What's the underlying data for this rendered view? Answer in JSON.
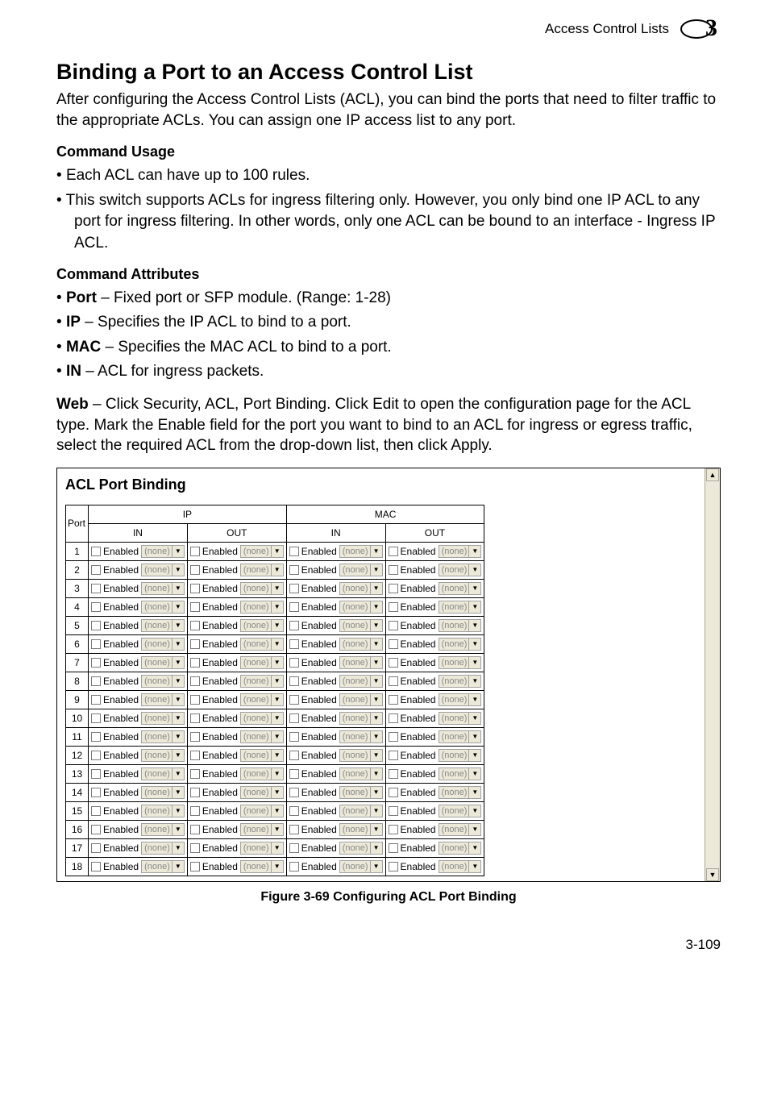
{
  "header": {
    "section": "Access Control Lists",
    "chapter": "3"
  },
  "title": "Binding a Port to an Access Control List",
  "intro": "After configuring the Access Control Lists (ACL), you can bind the ports that need to filter traffic to the appropriate ACLs. You can assign one IP access list to any port.",
  "usage_heading": "Command Usage",
  "usage_items": [
    "Each ACL can have up to 100 rules.",
    "This switch supports ACLs for ingress filtering only. However, you only bind one IP ACL to any port for ingress filtering. In other words, only one ACL can be bound to an interface - Ingress IP ACL."
  ],
  "attrs_heading": "Command Attributes",
  "attr_items": [
    {
      "term": "Port",
      "desc": " – Fixed port or SFP module. (Range: 1-28)"
    },
    {
      "term": "IP",
      "desc": " – Specifies the IP ACL to bind to a port."
    },
    {
      "term": "MAC",
      "desc": " – Specifies the MAC ACL to bind to a port."
    },
    {
      "term": "IN",
      "desc": " – ACL for ingress packets."
    }
  ],
  "web_label": "Web",
  "web_text": " – Click Security, ACL, Port Binding. Click Edit to open the configuration page for the ACL type. Mark the Enable field for the port you want to bind to an ACL for ingress or egress traffic, select the required ACL from the drop-down list, then click Apply.",
  "screenshot": {
    "heading": "ACL Port Binding",
    "cols": {
      "port": "Port",
      "ip": "IP",
      "mac": "MAC",
      "in": "IN",
      "out": "OUT"
    },
    "enabled_label": "Enabled",
    "select_value": "(none)",
    "ports": [
      "1",
      "2",
      "3",
      "4",
      "5",
      "6",
      "7",
      "8",
      "9",
      "10",
      "11",
      "12",
      "13",
      "14",
      "15",
      "16",
      "17",
      "18"
    ]
  },
  "figure_caption": "Figure 3-69  Configuring ACL Port Binding",
  "page_number": "3-109"
}
